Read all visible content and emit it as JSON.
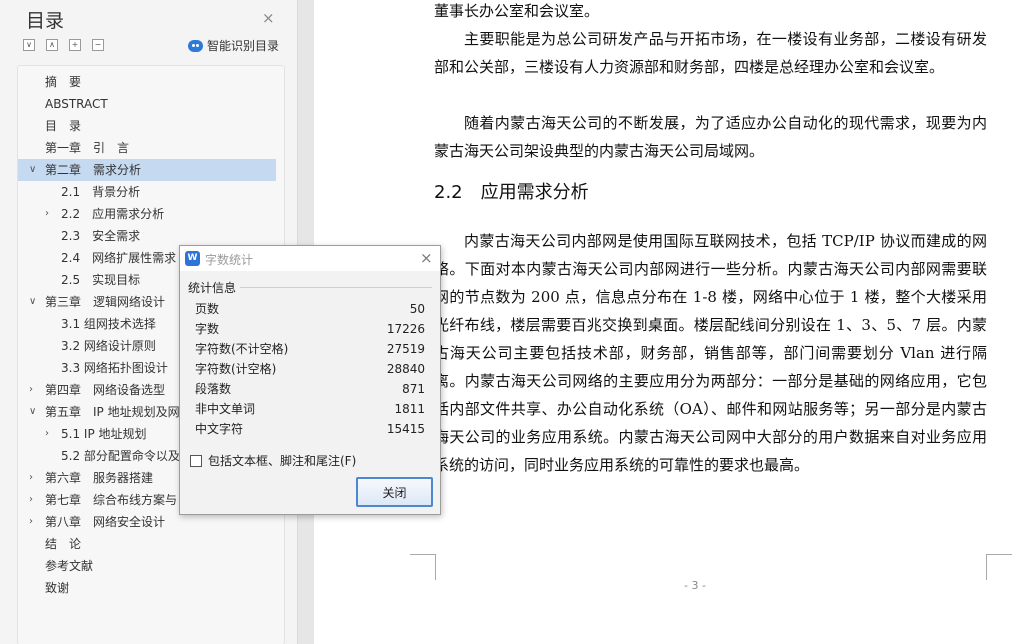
{
  "colors": {
    "selection": "#c5d9f1",
    "accent": "#2f73d8",
    "button_border": "#4e86cf"
  },
  "toc": {
    "title": "目录",
    "close_icon": "×",
    "controls": [
      {
        "name": "collapse-all-icon",
        "glyph": "∨"
      },
      {
        "name": "expand-up-icon",
        "glyph": "∧"
      },
      {
        "name": "add-heading-icon",
        "glyph": "+"
      },
      {
        "name": "remove-heading-icon",
        "glyph": "−"
      }
    ],
    "smart_button": "智能识别目录",
    "items": [
      {
        "label": "摘　要",
        "level": 1,
        "arrow": "",
        "selected": false
      },
      {
        "label": "ABSTRACT",
        "level": 1,
        "arrow": "",
        "selected": false
      },
      {
        "label": "目　录",
        "level": 1,
        "arrow": "",
        "selected": false
      },
      {
        "label": "第一章　引　言",
        "level": 1,
        "arrow": "",
        "selected": false
      },
      {
        "label": "第二章　需求分析",
        "level": 1,
        "arrow": "∨",
        "selected": true
      },
      {
        "label": "2.1　背景分析",
        "level": 2,
        "arrow": "",
        "selected": false
      },
      {
        "label": "2.2　应用需求分析",
        "level": 2,
        "arrow": "›",
        "selected": false
      },
      {
        "label": "2.3　安全需求",
        "level": 2,
        "arrow": "",
        "selected": false
      },
      {
        "label": "2.4　网络扩展性需求",
        "level": 2,
        "arrow": "",
        "selected": false
      },
      {
        "label": "2.5　实现目标",
        "level": 2,
        "arrow": "",
        "selected": false
      },
      {
        "label": "第三章　逻辑网络设计",
        "level": 1,
        "arrow": "∨",
        "selected": false
      },
      {
        "label": "3.1 组网技术选择",
        "level": 2,
        "arrow": "",
        "selected": false
      },
      {
        "label": "3.2 网络设计原则",
        "level": 2,
        "arrow": "",
        "selected": false
      },
      {
        "label": "3.3 网络拓扑图设计",
        "level": 2,
        "arrow": "",
        "selected": false
      },
      {
        "label": "第四章　网络设备选型",
        "level": 1,
        "arrow": "›",
        "selected": false
      },
      {
        "label": "第五章　IP 地址规划及网",
        "level": 1,
        "arrow": "∨",
        "selected": false
      },
      {
        "label": "5.1 IP 地址规划",
        "level": 2,
        "arrow": "›",
        "selected": false
      },
      {
        "label": "5.2 部分配置命令以及",
        "level": 2,
        "arrow": "",
        "selected": false
      },
      {
        "label": "第六章　服务器搭建",
        "level": 1,
        "arrow": "›",
        "selected": false
      },
      {
        "label": "第七章　综合布线方案与",
        "level": 1,
        "arrow": "›",
        "selected": false
      },
      {
        "label": "第八章　网络安全设计",
        "level": 1,
        "arrow": "›",
        "selected": false
      },
      {
        "label": "结　论",
        "level": 1,
        "arrow": "",
        "selected": false
      },
      {
        "label": "参考文献",
        "level": 1,
        "arrow": "",
        "selected": false
      },
      {
        "label": "致谢",
        "level": 1,
        "arrow": "",
        "selected": false
      }
    ]
  },
  "document": {
    "paragraphs": [
      "董事长办公室和会议室。",
      "主要职能是为总公司研发产品与开拓市场，在一楼设有业务部，二楼设有研发部和公关部，三楼设有人力资源部和财务部，四楼是总经理办公室和会议室。",
      "随着内蒙古海天公司的不断发展，为了适应办公自动化的现代需求，现要为内蒙古海天公司架设典型的内蒙古海天公司局域网。",
      "内蒙古海天公司内部网是使用国际互联网技术，包括 TCP/IP 协议而建成的网络。下面对本内蒙古海天公司内部网进行一些分析。内蒙古海天公司内部网需要联网的节点数为 200 点，信息点分布在 1-8 楼，网络中心位于 1 楼，整个大楼采用光纤布线，楼层需要百兆交换到桌面。楼层配线间分别设在 1、3、5、7 层。内蒙古海天公司主要包括技术部，财务部，销售部等，部门间需要划分 Vlan 进行隔离。内蒙古海天公司网络的主要应用分为两部分：一部分是基础的网络应用，它包括内部文件共享、办公自动化系统（OA）、邮件和网站服务等；另一部分是内蒙古海天公司的业务应用系统。内蒙古海天公司网中大部分的用户数据来自对业务应用系统的访问，同时业务应用系统的可靠性的要求也最高。"
    ],
    "heading": "2.2　应用需求分析",
    "page_number": "- 3 -"
  },
  "word_count": {
    "logo": "W",
    "title": "字数统计",
    "close_icon": "×",
    "section_label": "统计信息",
    "rows": [
      {
        "label": "页数",
        "value": "50"
      },
      {
        "label": "字数",
        "value": "17226"
      },
      {
        "label": "字符数(不计空格)",
        "value": "27519"
      },
      {
        "label": "字符数(计空格)",
        "value": "28840"
      },
      {
        "label": "段落数",
        "value": "871"
      },
      {
        "label": "非中文单词",
        "value": "1811"
      },
      {
        "label": "中文字符",
        "value": "15415"
      }
    ],
    "checkbox_label": "包括文本框、脚注和尾注(F)",
    "checkbox_checked": false,
    "ok_button": "关闭"
  }
}
